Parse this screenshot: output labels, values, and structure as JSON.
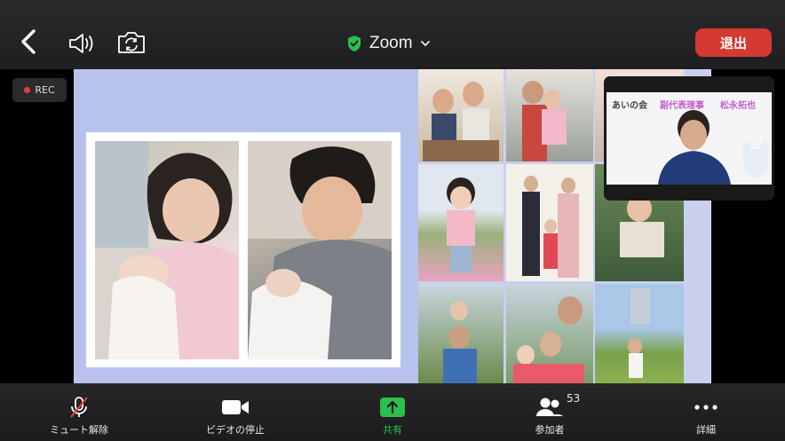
{
  "header": {
    "title": "Zoom",
    "leave_label": "退出",
    "icons": [
      "back-chevron-icon",
      "speaker-icon",
      "camera-switch-icon",
      "shield-check-icon",
      "chevron-down-icon"
    ],
    "shield_color": "#2bbf4e",
    "leave_color": "#d43a31"
  },
  "recording": {
    "label": "REC"
  },
  "participant_tile": {
    "org": "あいの会",
    "role": "副代表理事",
    "name": "松永拓也"
  },
  "toolbar": {
    "mute_label": "ミュート解除",
    "video_label": "ビデオの停止",
    "share_label": "共有",
    "participants_label": "参加者",
    "participants_count": "53",
    "more_label": "詳細"
  }
}
